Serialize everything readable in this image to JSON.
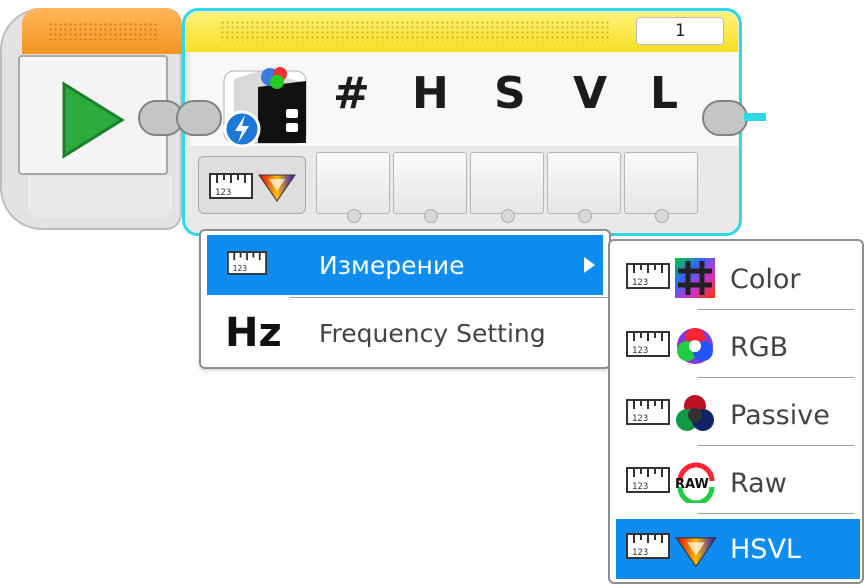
{
  "start_block": {
    "icon": "play-icon",
    "color": "#f29320"
  },
  "sensor_block": {
    "port": "1",
    "outputs": [
      "#",
      "H",
      "S",
      "V",
      "L"
    ],
    "sensor_icon": "color-sensor-icon",
    "mode_icon": "measure-hsvl-icon",
    "border_color": "#2ed8e8",
    "header_color": "#f6de22"
  },
  "mode_menu": {
    "items": [
      {
        "label": "Измерение",
        "icon": "measure-icon",
        "selected": true,
        "has_submenu": true
      },
      {
        "label": "Frequency Setting",
        "icon_text": "Hz",
        "selected": false
      }
    ]
  },
  "submenu": {
    "items": [
      {
        "label": "Color",
        "icon": "color-grid-icon",
        "selected": false
      },
      {
        "label": "RGB",
        "icon": "rgb-circles-icon",
        "selected": false
      },
      {
        "label": "Passive",
        "icon": "passive-circles-icon",
        "selected": false
      },
      {
        "label": "Raw",
        "icon": "raw-icon",
        "icon_text": "RAW",
        "selected": false
      },
      {
        "label": "HSVL",
        "icon": "hsvl-triangle-icon",
        "selected": true
      }
    ]
  },
  "colors": {
    "selection": "#0f8cf0",
    "text": "#444444"
  }
}
